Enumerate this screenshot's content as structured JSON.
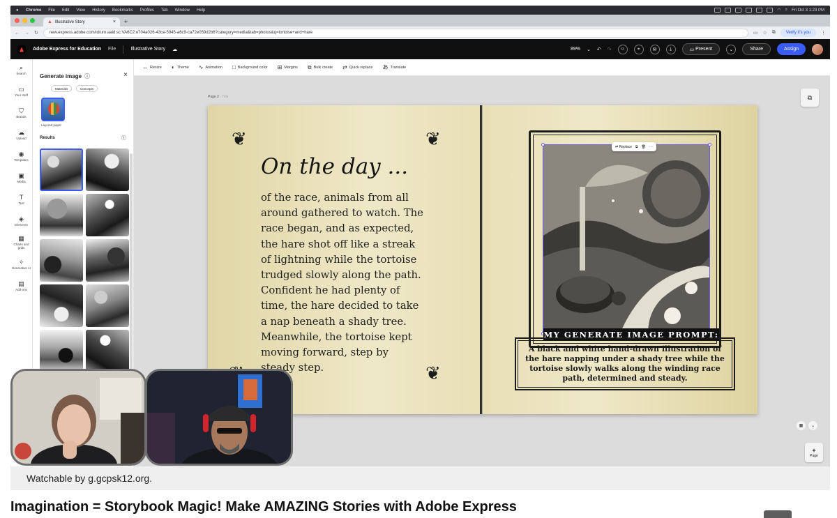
{
  "mac": {
    "app": "Chrome",
    "menus": [
      "File",
      "Edit",
      "View",
      "History",
      "Bookmarks",
      "Profiles",
      "Tab",
      "Window",
      "Help"
    ],
    "clock": "Fri Oct 3  1:23 PM"
  },
  "browser": {
    "tab_title": "Illustrative Story",
    "url": "new.express.adobe.com/id/urn:aaid:sc:VA6C2:e704a026-43ce-5945-a6c9-ca72e059d2b6?category=media&tab=photos&q=tortoise+and+hare",
    "verify_label": "Verify it's you"
  },
  "app": {
    "name": "Adobe Express for Education",
    "file_menu": "File",
    "doc_title": "Illustrative Story",
    "zoom": "89%",
    "present_label": "Present",
    "share_label": "Share",
    "assign_label": "Assign"
  },
  "rail": [
    {
      "label": "Search",
      "icon": "search-icon",
      "glyph": "⌕"
    },
    {
      "label": "Your stuff",
      "icon": "folder-icon",
      "glyph": "▭"
    },
    {
      "label": "Brands",
      "icon": "brand-icon",
      "glyph": "⛉"
    },
    {
      "label": "Upload",
      "icon": "upload-icon",
      "glyph": "☁"
    },
    {
      "label": "Templates",
      "icon": "templates-icon",
      "glyph": "◉"
    },
    {
      "label": "Media",
      "icon": "media-icon",
      "glyph": "▣"
    },
    {
      "label": "Text",
      "icon": "text-icon",
      "glyph": "T"
    },
    {
      "label": "Elements",
      "icon": "elements-icon",
      "glyph": "◈"
    },
    {
      "label": "Charts and grids",
      "icon": "charts-icon",
      "glyph": "▦"
    },
    {
      "label": "Generative AI",
      "icon": "generative-ai-icon",
      "glyph": "✧"
    },
    {
      "label": "Add-ons",
      "icon": "addons-icon",
      "glyph": "▤"
    }
  ],
  "panel": {
    "title": "Generate image",
    "chips": [
      "Materials",
      "Concepts"
    ],
    "style_label": "Layered paper",
    "results_label": "Results"
  },
  "toolbar": [
    "Resize",
    "Theme",
    "Animation",
    "Background color",
    "Margins",
    "Bulk create",
    "Quick replace",
    "Translate"
  ],
  "toolbar_icons": [
    "↔",
    "◐",
    "∿",
    "□",
    "⊞",
    "⧉",
    "⇄",
    "あ"
  ],
  "canvas": {
    "page_label": "Page 2",
    "page_title_placeholder": "Title",
    "add_page_label": "Page",
    "selection_replace": "Replace"
  },
  "story": {
    "heading": "On the day ...",
    "lines": [
      "of the race, animals from all",
      "around gathered to watch. The",
      "race began, and as expected,",
      "the hare shot off like a streak",
      "of lightning while the tortoise",
      "trudged slowly along the path.",
      "Confident he had plenty of",
      "time, the hare decided to take",
      "a nap beneath a shady tree.",
      "Meanwhile, the tortoise kept",
      "moving forward, step by",
      "steady step."
    ],
    "prompt_title": "MY GENERATE IMAGE PROMPT:",
    "prompt_text": "A black and white hand-drawn illustration of the hare napping under a shady tree while the tortoise slowly walks along the winding race path, determined and steady."
  },
  "video": {
    "attribution": "Watchable by g.gcpsk12.org.",
    "title": "Imagination = Storybook Magic! Make AMAZING Stories with Adobe Express"
  }
}
